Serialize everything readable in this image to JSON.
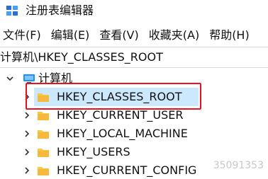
{
  "window": {
    "title": "注册表编辑器",
    "icon": "regedit-icon"
  },
  "menu": {
    "items": [
      {
        "label": "文件(F)"
      },
      {
        "label": "编辑(E)"
      },
      {
        "label": "查看(V)"
      },
      {
        "label": "收藏夹(A)"
      },
      {
        "label": "帮助(H)"
      }
    ]
  },
  "address": {
    "path": "计算机\\HKEY_CLASSES_ROOT"
  },
  "tree": {
    "root": {
      "label": "计算机",
      "icon": "computer-icon",
      "expanded": true
    },
    "children": [
      {
        "label": "HKEY_CLASSES_ROOT",
        "icon": "folder-icon",
        "selected": true
      },
      {
        "label": "HKEY_CURRENT_USER",
        "icon": "folder-icon"
      },
      {
        "label": "HKEY_LOCAL_MACHINE",
        "icon": "folder-icon"
      },
      {
        "label": "HKEY_USERS",
        "icon": "folder-icon"
      },
      {
        "label": "HKEY_CURRENT_CONFIG",
        "icon": "folder-icon"
      }
    ]
  },
  "colors": {
    "selection": "#cce8ff",
    "highlight_border": "#e81123",
    "folder": "#f8c848"
  },
  "watermark": {
    "text": "35091353"
  }
}
